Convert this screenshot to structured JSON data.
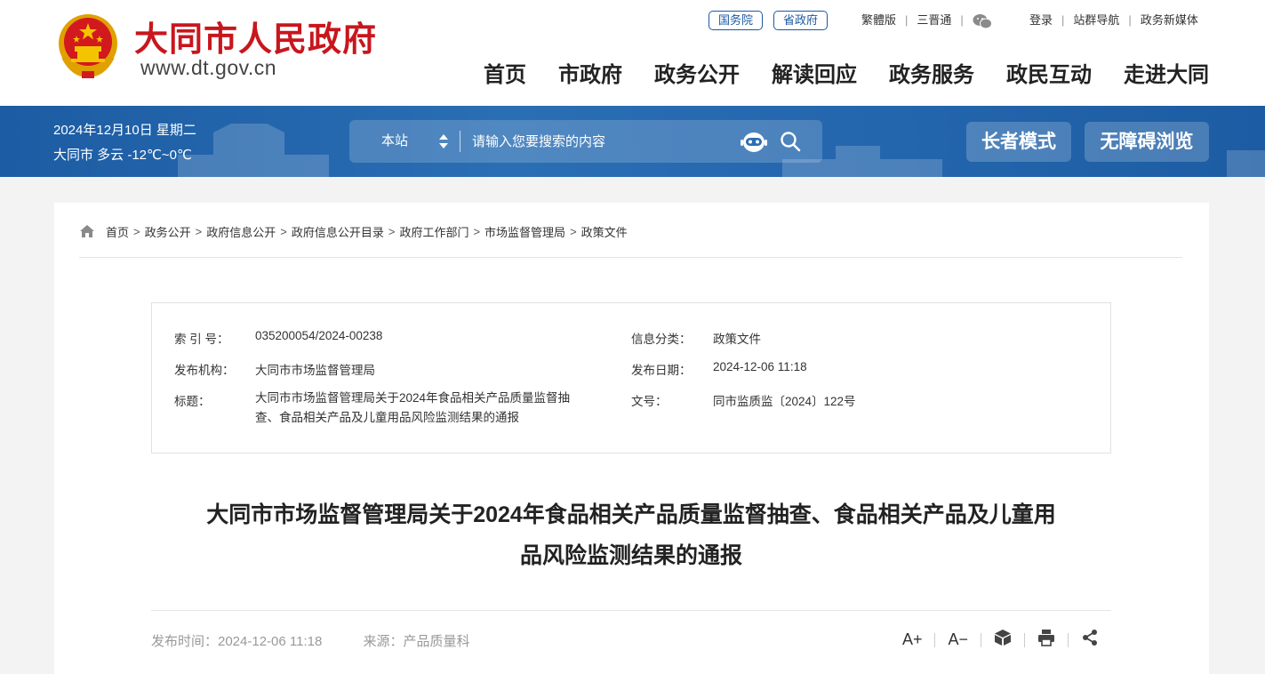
{
  "header": {
    "site_name": "大同市人民政府",
    "site_url": "www.dt.gov.cn",
    "pill_links": [
      "国务院",
      "省政府"
    ],
    "top_links_left": [
      "繁體版",
      "三晋通"
    ],
    "top_links_right": [
      "登录",
      "站群导航",
      "政务新媒体"
    ],
    "nav": [
      "首页",
      "市政府",
      "政务公开",
      "解读回应",
      "政务服务",
      "政民互动",
      "走进大同"
    ]
  },
  "banner": {
    "date": "2024年12月10日 星期二",
    "weather": "大同市 多云 -12℃~0℃",
    "search_scope": "本站",
    "search_placeholder": "请输入您要搜索的内容",
    "elder_mode": "长者模式",
    "accessible": "无障碍浏览"
  },
  "breadcrumb": [
    "首页",
    "政务公开",
    "政府信息公开",
    "政府信息公开目录",
    "政府工作部门",
    "市场监督管理局",
    "政策文件"
  ],
  "meta": {
    "index_label": "索 引 号：",
    "index_value": "035200054/2024-00238",
    "category_label": "信息分类：",
    "category_value": "政策文件",
    "org_label": "发布机构：",
    "org_value": "大同市市场监督管理局",
    "date_label": "发布日期：",
    "date_value": "2024-12-06 11:18",
    "title_label": "标题：",
    "title_value_line1": "大同市市场监督管理局关于2024年食品相关产品质量监督抽",
    "title_value_line2": "查、食品相关产品及儿童用品风险监测结果的通报",
    "docno_label": "文号：",
    "docno_value": "同市监质监〔2024〕122号"
  },
  "article": {
    "title_line1": "大同市市场监督管理局关于2024年食品相关产品质量监督抽查、食品相关产品及儿童用",
    "title_line2": "品风险监测结果的通报",
    "publish_time": "发布时间：2024-12-06 11:18",
    "source": "来源：产品质量科"
  },
  "tools": {
    "font_larger": "A+",
    "font_smaller": "A−"
  }
}
